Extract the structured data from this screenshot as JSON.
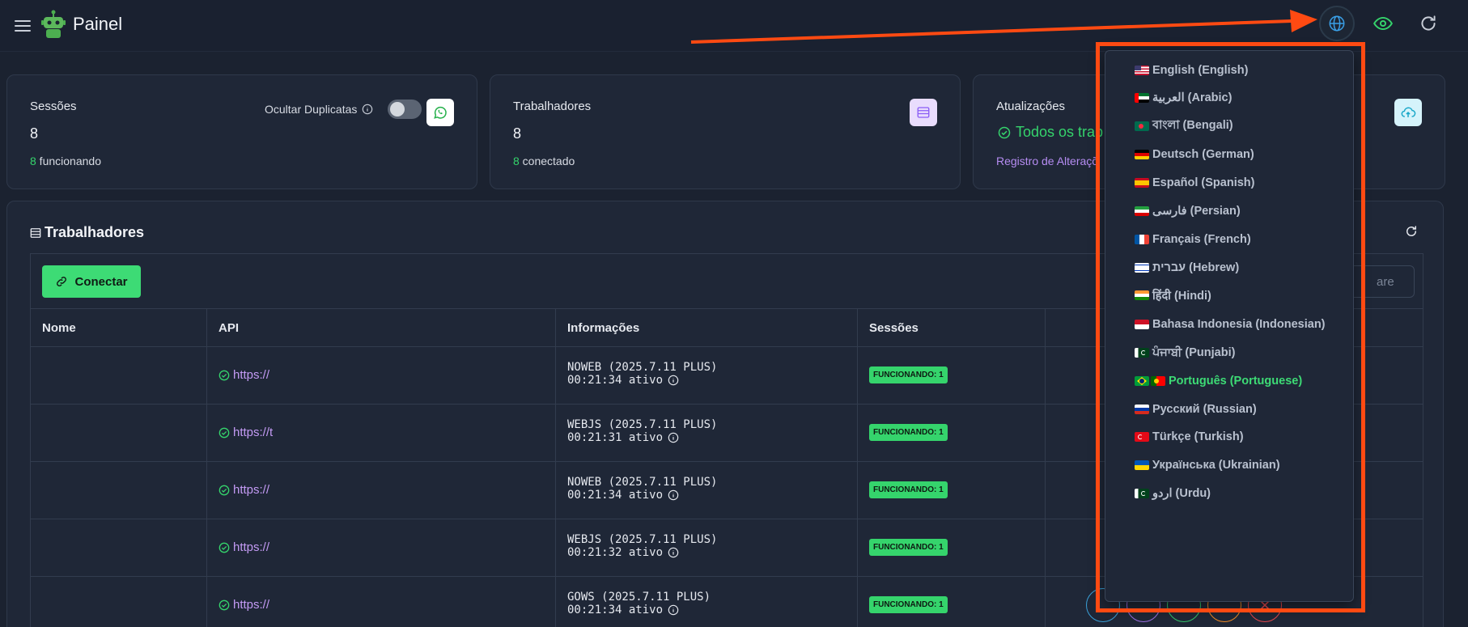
{
  "app": {
    "title": "Painel"
  },
  "cards": {
    "sessions": {
      "title": "Sessões",
      "value": "8",
      "sub_num": "8",
      "sub_text": " funcionando",
      "dup_label": "Ocultar Duplicatas"
    },
    "workers": {
      "title": "Trabalhadores",
      "value": "8",
      "sub_num": "8",
      "sub_text": " conectado"
    },
    "updates": {
      "title": "Atualizações",
      "status": "Todos os trab",
      "link": "Registro de Alteraçõ"
    }
  },
  "panel": {
    "title": "Trabalhadores",
    "connect_label": "Conectar",
    "search_placeholder": "are",
    "columns": [
      "Nome",
      "API",
      "Informações",
      "Sessões"
    ],
    "rows": [
      {
        "api": "https://",
        "info_line1": "NOWEB (2025.7.11 PLUS)",
        "info_line2": "00:21:34 ativo",
        "badge": "FUNCIONANDO: 1"
      },
      {
        "api": "https://t",
        "info_line1": "WEBJS (2025.7.11 PLUS)",
        "info_line2": "00:21:31 ativo",
        "badge": "FUNCIONANDO: 1"
      },
      {
        "api": "https://",
        "info_line1": "NOWEB (2025.7.11 PLUS)",
        "info_line2": "00:21:34 ativo",
        "badge": "FUNCIONANDO: 1"
      },
      {
        "api": "https://",
        "info_line1": "WEBJS (2025.7.11 PLUS)",
        "info_line2": "00:21:32 ativo",
        "badge": "FUNCIONANDO: 1"
      },
      {
        "api": "https://",
        "info_line1": "GOWS (2025.7.11 PLUS)",
        "info_line2": "00:21:34 ativo",
        "badge": "FUNCIONANDO: 1"
      }
    ]
  },
  "language_menu": {
    "items": [
      {
        "label": "English (English)",
        "flag": "us-flag",
        "active": false
      },
      {
        "label": "العربية (Arabic)",
        "flag": "ae-flag",
        "active": false
      },
      {
        "label": "বাংলা (Bengali)",
        "flag": "bd-flag",
        "active": false
      },
      {
        "label": "Deutsch (German)",
        "flag": "de-flag",
        "active": false
      },
      {
        "label": "Español (Spanish)",
        "flag": "es-flag",
        "active": false
      },
      {
        "label": "فارسی (Persian)",
        "flag": "ir-flag",
        "active": false
      },
      {
        "label": "Français (French)",
        "flag": "fr-flag",
        "active": false
      },
      {
        "label": "עברית (Hebrew)",
        "flag": "il-flag",
        "active": false
      },
      {
        "label": "हिंदी (Hindi)",
        "flag": "in-flag",
        "active": false
      },
      {
        "label": "Bahasa Indonesia (Indonesian)",
        "flag": "id-flag",
        "active": false
      },
      {
        "label": "ਪੰਜਾਬੀ (Punjabi)",
        "flag": "pk-flag",
        "active": false
      },
      {
        "label": "Português (Portuguese)",
        "flag": "br-pt-flag",
        "active": true
      },
      {
        "label": "Русский (Russian)",
        "flag": "ru-flag",
        "active": false
      },
      {
        "label": "Türkçe (Turkish)",
        "flag": "tr-flag",
        "active": false
      },
      {
        "label": "Українська (Ukrainian)",
        "flag": "ua-flag",
        "active": false
      },
      {
        "label": "اردو (Urdu)",
        "flag": "pk-flag",
        "active": false
      }
    ]
  },
  "colors": {
    "accent_green": "#3ddb75",
    "annotation": "#ff4a12",
    "link_purple": "#c49bf5"
  }
}
